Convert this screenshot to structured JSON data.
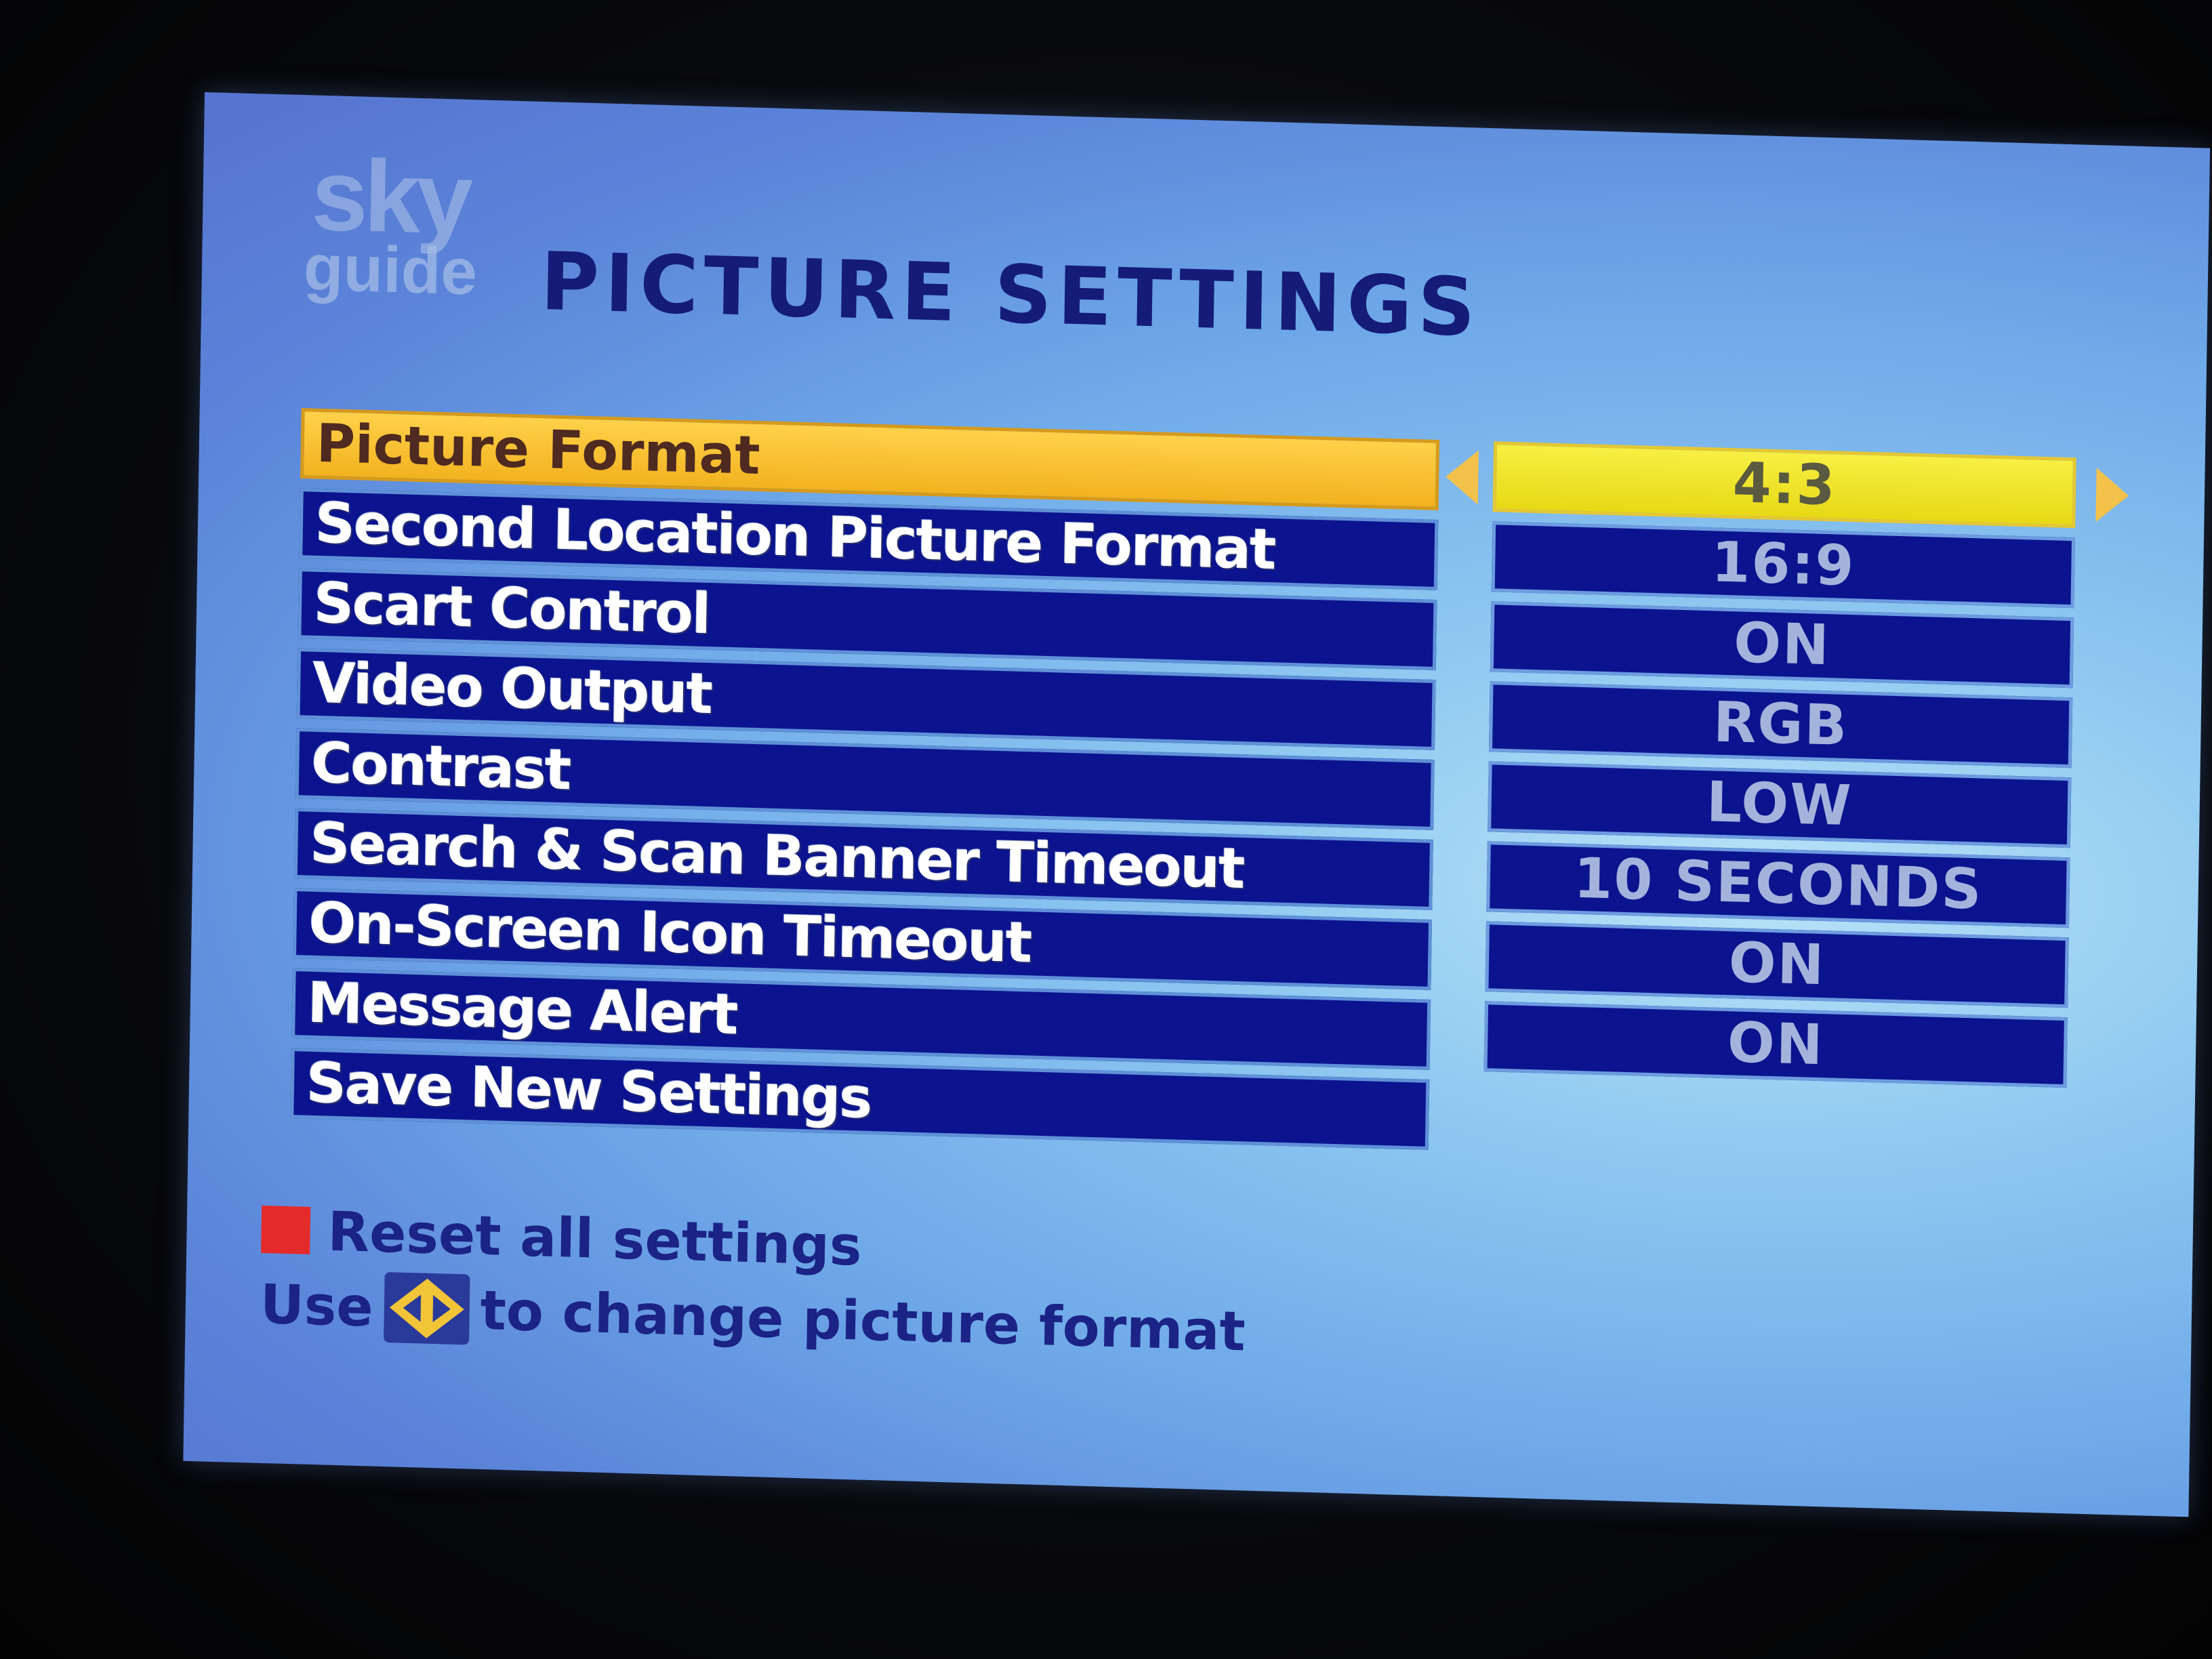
{
  "brand": {
    "logo_top": "sky",
    "logo_bottom": "guide"
  },
  "page": {
    "title": "PICTURE SETTINGS"
  },
  "settings": [
    {
      "label": "Picture Format",
      "value": "4:3"
    },
    {
      "label": "Second Location Picture Format",
      "value": "16:9"
    },
    {
      "label": "Scart Control",
      "value": "ON"
    },
    {
      "label": "Video Output",
      "value": "RGB"
    },
    {
      "label": "Contrast",
      "value": "LOW"
    },
    {
      "label": "Search & Scan Banner Timeout",
      "value": "10 SECONDS"
    },
    {
      "label": "On-Screen Icon Timeout",
      "value": "ON"
    },
    {
      "label": "Message Alert",
      "value": "ON"
    }
  ],
  "save_label": "Save New Settings",
  "footer": {
    "reset_label": "Reset all settings",
    "hint_prefix": "Use",
    "hint_suffix": "to change picture format",
    "reset_key_icon": "red-key-icon",
    "hint_key_icon": "left-right-arrow-key-icon"
  },
  "colors": {
    "highlight": "#f2b21f",
    "highlight_value": "#e7d915",
    "row_background": "#0b148e",
    "title_text": "#141c78",
    "red_key": "#e52a2a"
  }
}
